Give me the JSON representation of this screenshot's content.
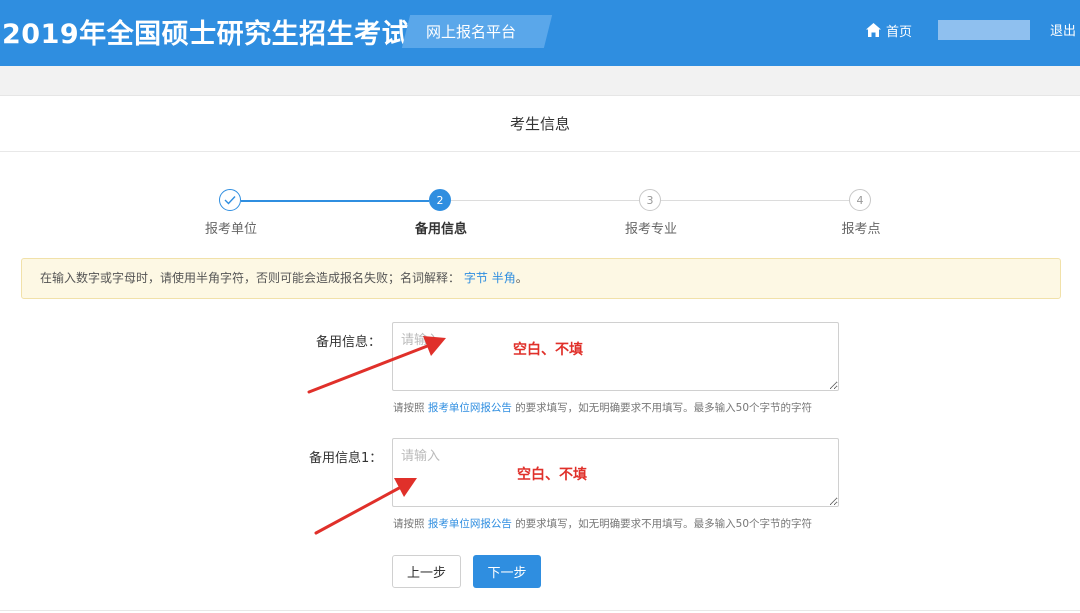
{
  "header": {
    "title": "2019年全国硕士研究生招生考试",
    "platform": "网上报名平台",
    "home_label": "首页",
    "logout_label": "退出"
  },
  "page": {
    "section_title": "考生信息"
  },
  "steps": [
    {
      "number": "✓",
      "label": "报考单位",
      "state": "done"
    },
    {
      "number": "2",
      "label": "备用信息",
      "state": "active"
    },
    {
      "number": "3",
      "label": "报考专业",
      "state": "pending"
    },
    {
      "number": "4",
      "label": "报考点",
      "state": "pending"
    }
  ],
  "notice": {
    "text": "在输入数字或字母时，请使用半角字符，否则可能会造成报名失败；名词解释：",
    "link1": "字节",
    "link2": "半角",
    "suffix": "。"
  },
  "form": {
    "field1": {
      "label": "备用信息：",
      "placeholder": "请输入",
      "value": "",
      "hint_prefix": "请按照",
      "hint_link": "报考单位网报公告",
      "hint_suffix": "的要求填写，如无明确要求不用填写。最多输入50个字节的字符"
    },
    "field2": {
      "label": "备用信息1：",
      "placeholder": "请输入",
      "value": "",
      "hint_prefix": "请按照",
      "hint_link": "报考单位网报公告",
      "hint_suffix": "的要求填写，如无明确要求不用填写。最多输入50个字节的字符"
    }
  },
  "annotations": {
    "note1": "空白、不填",
    "note2": "空白、不填",
    "color": "#e0302a"
  },
  "buttons": {
    "prev": "上一步",
    "next": "下一步"
  },
  "colors": {
    "primary": "#2f8ee0",
    "notice_bg": "#fdf8e4"
  }
}
